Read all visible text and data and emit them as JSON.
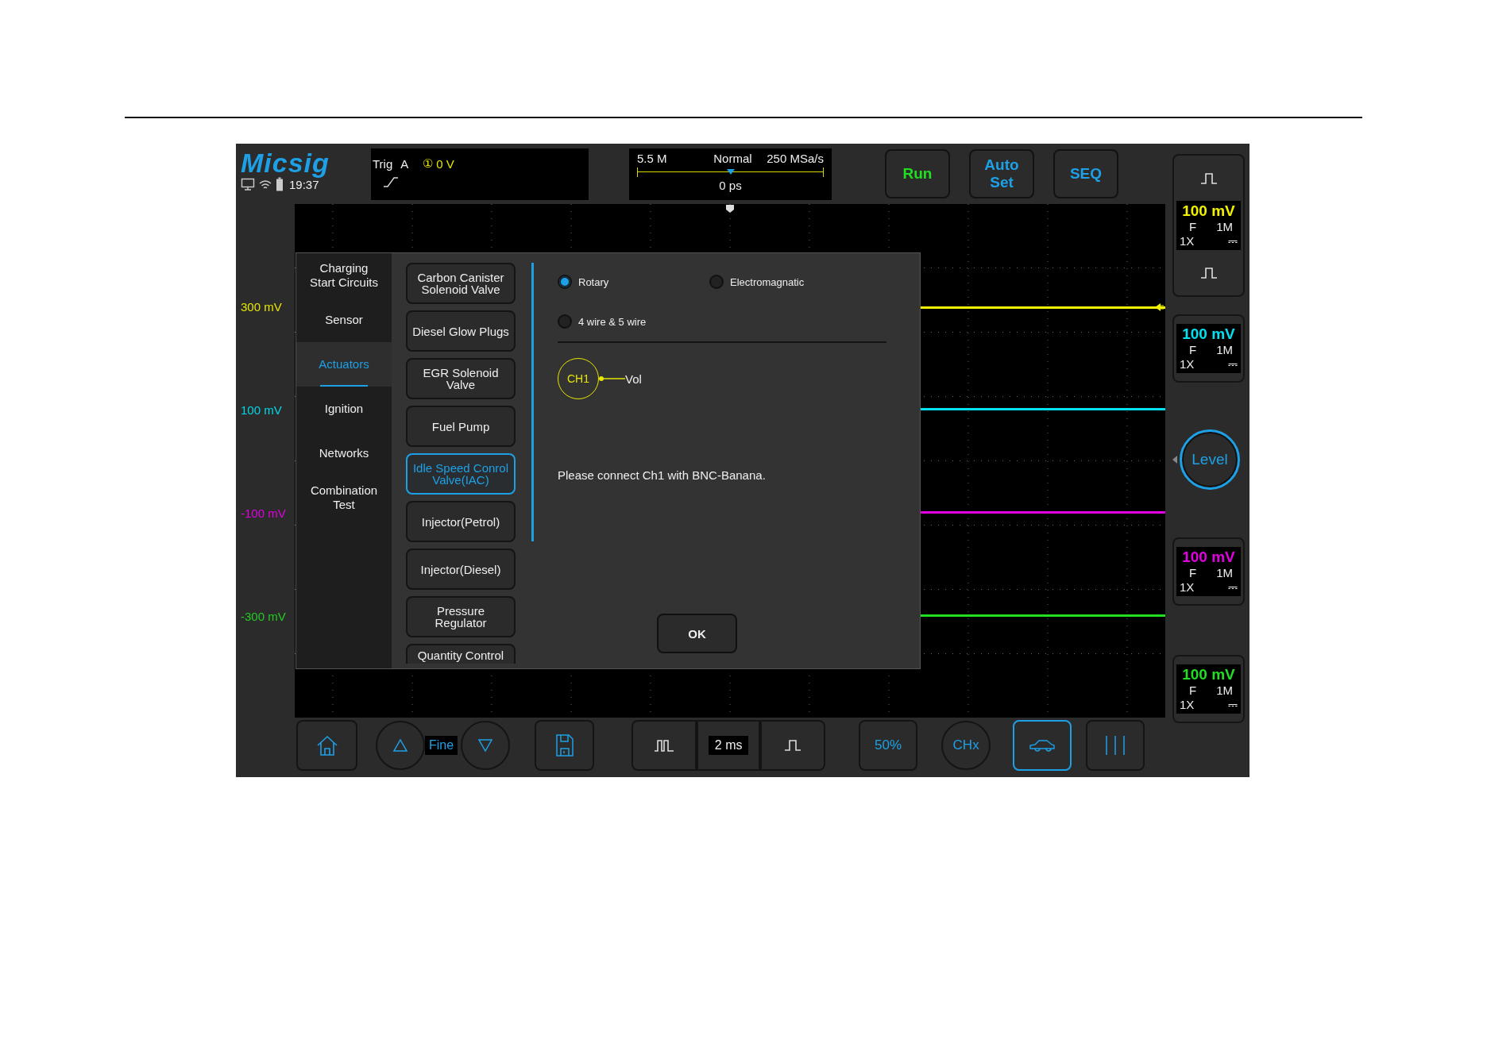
{
  "status": {
    "logo": "Micsig",
    "time": "19:37"
  },
  "trigger": {
    "label": "Trig",
    "source": "A",
    "channel_mark": "①",
    "level": "0 V"
  },
  "timebase": {
    "memory": "5.5 M",
    "mode": "Normal",
    "sample_rate": "250 MSa/s",
    "offset": "0 ps",
    "position": {
      "level": 0.5
    }
  },
  "top_buttons": [
    {
      "label": "Run",
      "color": "#22dd22"
    },
    {
      "label": "Auto Set",
      "color": "#1ea0e6"
    },
    {
      "label": "SEQ",
      "color": "#1ea0e6"
    }
  ],
  "axis_labels": [
    {
      "text": "300 mV",
      "color": "#e6e600"
    },
    {
      "text": "100 mV",
      "color": "#00d8e8"
    },
    {
      "text": "-100 mV",
      "color": "#e000e0"
    },
    {
      "text": "-300 mV",
      "color": "#22cc22"
    }
  ],
  "channels": [
    {
      "scale": "100 mV",
      "coupling": "F",
      "impedance": "1M",
      "probe": "1X",
      "dc": "⎓",
      "color": "#f0f000"
    },
    {
      "scale": "100 mV",
      "coupling": "F",
      "impedance": "1M",
      "probe": "1X",
      "dc": "⎓",
      "color": "#00e0f0"
    },
    {
      "scale": "100 mV",
      "coupling": "F",
      "impedance": "1M",
      "probe": "1X",
      "dc": "⎓",
      "color": "#e000e0"
    },
    {
      "scale": "100 mV",
      "coupling": "F",
      "impedance": "1M",
      "probe": "1X",
      "dc": "⎓",
      "color": "#22dd22"
    }
  ],
  "level_button": "Level",
  "dialog": {
    "categories": [
      {
        "label": "Charging Start Circuits",
        "selected": false
      },
      {
        "label": "Sensor",
        "selected": false
      },
      {
        "label": "Actuators",
        "selected": true
      },
      {
        "label": "Ignition",
        "selected": false
      },
      {
        "label": "Networks",
        "selected": false
      },
      {
        "label": "Combination Test",
        "selected": false
      }
    ],
    "tests": [
      {
        "label": "Carbon Canister Solenoid Valve",
        "selected": false
      },
      {
        "label": "Diesel Glow Plugs",
        "selected": false
      },
      {
        "label": "EGR Solenoid Valve",
        "selected": false
      },
      {
        "label": "Fuel Pump",
        "selected": false
      },
      {
        "label": "Idle Speed Conrol Valve(IAC)",
        "selected": true
      },
      {
        "label": "Injector(Petrol)",
        "selected": false
      },
      {
        "label": "Injector(Diesel)",
        "selected": false
      },
      {
        "label": "Pressure Regulator",
        "selected": false
      },
      {
        "label": "Quantity Control",
        "selected": false
      }
    ],
    "options": [
      {
        "label": "Rotary",
        "selected": true
      },
      {
        "label": "Electromagnatic",
        "selected": false
      },
      {
        "label": "4 wire & 5 wire",
        "selected": false
      }
    ],
    "connection": {
      "channel": "CH1",
      "signal": "Vol"
    },
    "message": "Please connect Ch1 with BNC-Banana.",
    "ok": "OK"
  },
  "toolbar": {
    "fine": "Fine",
    "time_scale": "2 ms",
    "percent": "50%",
    "channel": "CHx",
    "auto_selected": true
  }
}
